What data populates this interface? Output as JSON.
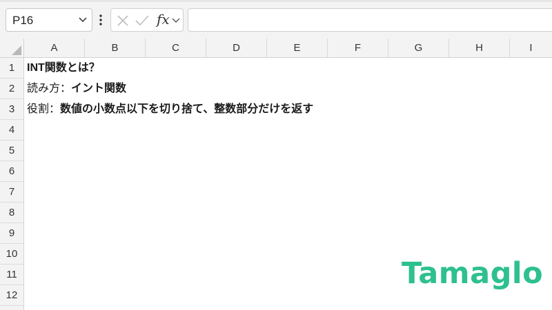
{
  "name_box": {
    "value": "P16"
  },
  "formula": {
    "fx_label": "fx",
    "value": ""
  },
  "columns": [
    "A",
    "B",
    "C",
    "D",
    "E",
    "F",
    "G",
    "H",
    "I"
  ],
  "rows": [
    "1",
    "2",
    "3",
    "4",
    "5",
    "6",
    "7",
    "8",
    "9",
    "10",
    "11",
    "12"
  ],
  "cells": {
    "A1": "INT関数とは？",
    "A2_prefix": "読み方：",
    "A2_value": "イント関数",
    "A3_prefix": "役割：",
    "A3_value": "数値の小数点以下を切り捨て、整数部分だけを返す"
  },
  "logo": "Tamaglo",
  "colors": {
    "logo": "#2ec08e",
    "header_bg": "#f3f3f3",
    "gridline": "#d9d9d9"
  },
  "icons": [
    "chevron-down-icon",
    "more-vertical-icon",
    "cancel-icon",
    "check-icon",
    "function-icon",
    "select-all-icon"
  ]
}
